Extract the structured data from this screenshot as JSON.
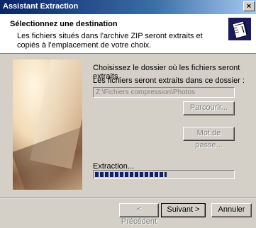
{
  "window": {
    "title": "Assistant Extraction",
    "close_label": "×"
  },
  "header": {
    "title": "Sélectionnez une destination",
    "description": "Les fichiers situés dans l'archive ZIP seront extraits et copiés à l'emplacement de votre choix."
  },
  "main": {
    "instruction": "Choisissez le dossier où les fichiers seront extraits.",
    "target_label": "Les fichiers seront extraits dans ce dossier :",
    "target_path": "Z:\\Fichiers compression\\Photos",
    "browse_label": "Parcourir...",
    "password_label": "Mot de passe...",
    "progress_label": "Extraction...",
    "progress_fraction": 0.52
  },
  "footer": {
    "prev_label": "< Précédent",
    "next_label": "Suivant >",
    "cancel_label": "Annuler"
  }
}
